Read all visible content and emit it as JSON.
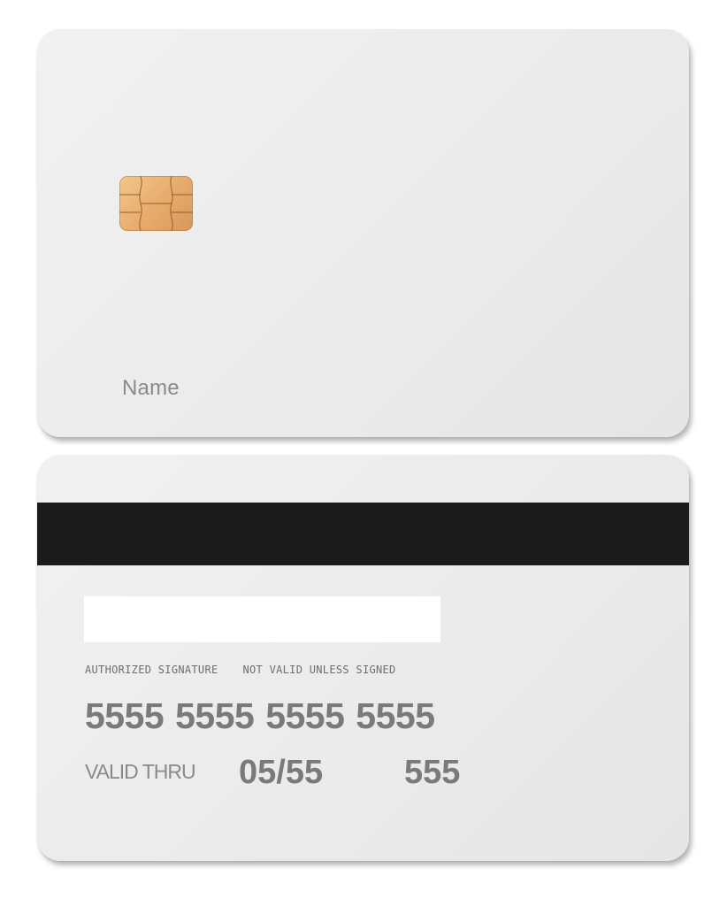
{
  "front": {
    "name_label": "Name"
  },
  "back": {
    "authorized_signature": "AUTHORIZED SIGNATURE",
    "not_valid": "NOT VALID UNLESS SIGNED",
    "card_number": "5555 5555 5555 5555",
    "valid_thru_label": "VALID THRU",
    "expiry": "05/55",
    "cvv": "555"
  },
  "colors": {
    "card": "#ececec",
    "stripe": "#1b1b1b",
    "chip": "#e7ab6c",
    "text": "#7a7a7a"
  },
  "icons": {
    "chip": "emv-chip-icon"
  }
}
